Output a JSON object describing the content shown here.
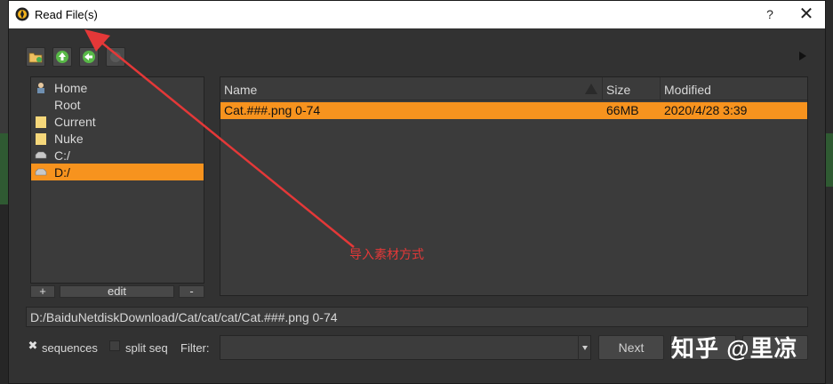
{
  "window": {
    "title": "Read File(s)",
    "help_label": "?",
    "close_label": "✕"
  },
  "toolbar": {
    "buttons": [
      "new-folder-icon",
      "up-folder-icon",
      "back-icon",
      "record-icon"
    ]
  },
  "places": {
    "items": [
      {
        "label": "Home",
        "icon": "home-icon"
      },
      {
        "label": "Root",
        "icon": ""
      },
      {
        "label": "Current",
        "icon": "folder-icon"
      },
      {
        "label": "Nuke",
        "icon": "folder-icon"
      },
      {
        "label": "C:/",
        "icon": "drive-icon"
      },
      {
        "label": "D:/",
        "icon": "drive-icon",
        "selected": true
      }
    ],
    "add_label": "+",
    "edit_label": "edit",
    "remove_label": "-"
  },
  "files": {
    "columns": [
      "Name",
      "Size",
      "Modified"
    ],
    "rows": [
      {
        "name": "Cat.###.png 0-74",
        "size": "66MB",
        "modified": "2020/4/28 3:39"
      }
    ]
  },
  "path_field": {
    "value": "D:/BaiduNetdiskDownload/Cat/cat/cat/Cat.###.png 0-74"
  },
  "options": {
    "sequences_label": "sequences",
    "sequences_checked": true,
    "split_seq_label": "split seq",
    "split_seq_checked": false,
    "filter_label": "Filter:",
    "filter_value": ""
  },
  "buttons": {
    "next_label": "Next"
  },
  "annotation": {
    "text": "导入素材方式",
    "color": "#e43838"
  },
  "watermark": {
    "text": "知乎 @里凉"
  },
  "colors": {
    "accent": "#f7931e",
    "panel": "#3b3b3b",
    "window": "#323232"
  }
}
